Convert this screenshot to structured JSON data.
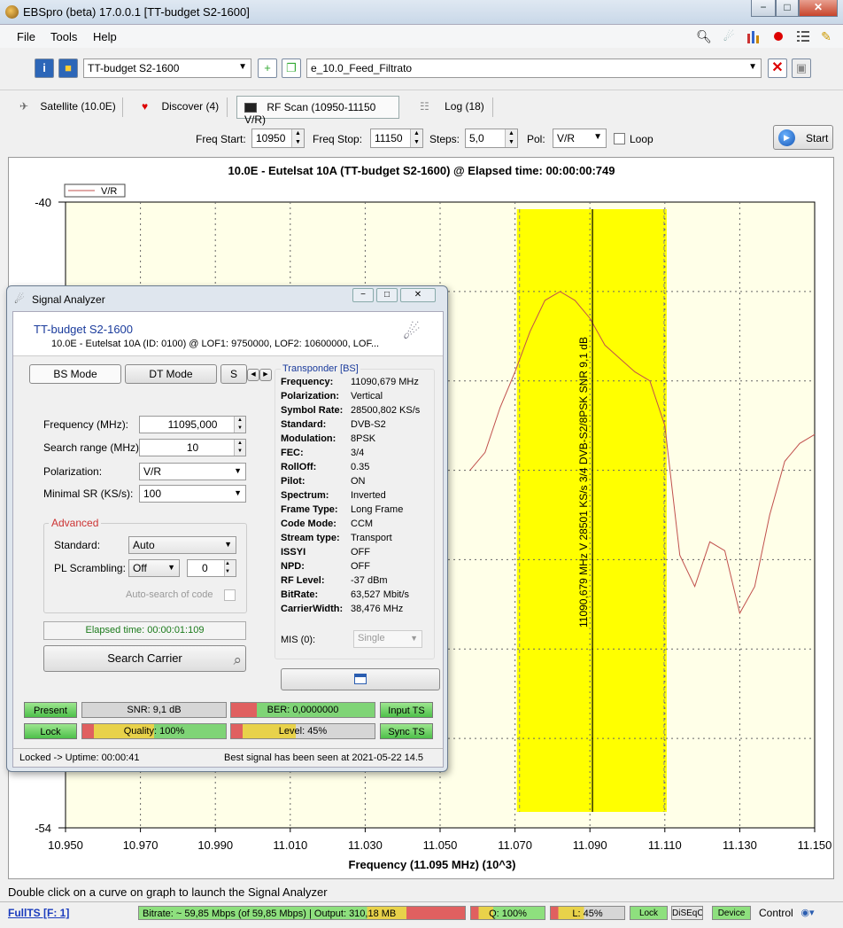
{
  "window": {
    "title": "EBSpro (beta) 17.0.0.1 [TT-budget S2-1600]",
    "min": "−",
    "max": "□",
    "close": "✕"
  },
  "menu": [
    "File",
    "Tools",
    "Help"
  ],
  "toolbar": {
    "device": "TT-budget S2-1600",
    "feed": "e_10.0_Feed_Filtrato"
  },
  "tabs": [
    {
      "label": "Satellite (10.0E)"
    },
    {
      "label": "Discover (4)"
    },
    {
      "label": "RF Scan (10950-11150 V/R)"
    },
    {
      "label": "Log (18)"
    }
  ],
  "scan": {
    "freq_start_label": "Freq Start:",
    "freq_start": "10950",
    "freq_stop_label": "Freq Stop:",
    "freq_stop": "11150",
    "steps_label": "Steps:",
    "steps": "5,0",
    "pol_label": "Pol:",
    "pol": "V/R",
    "loop_label": "Loop",
    "start_label": "Start"
  },
  "chart_data": {
    "type": "line",
    "title": "10.0E  -  Eutelsat 10A    (TT-budget S2-1600) @ Elapsed time: 00:00:00:749",
    "xlabel": "Frequency (11.095 MHz) (10^3)",
    "ylabel": "",
    "xlim": [
      10.95,
      11.15
    ],
    "ylim": [
      -54,
      -40
    ],
    "x_ticks": [
      "10.950",
      "10.970",
      "10.990",
      "11.010",
      "11.030",
      "11.050",
      "11.070",
      "11.090",
      "11.110",
      "11.130",
      "11.150"
    ],
    "y_ticks": [
      "-40",
      "-54"
    ],
    "grid": true,
    "legend": "top-left",
    "series": [
      {
        "name": "V/R",
        "color": "#c0504d",
        "x": [
          11.058,
          11.062,
          11.066,
          11.07,
          11.074,
          11.078,
          11.082,
          11.086,
          11.09,
          11.094,
          11.098,
          11.102,
          11.106,
          11.11,
          11.114,
          11.118,
          11.122,
          11.126,
          11.13,
          11.134,
          11.138,
          11.142,
          11.146,
          11.15
        ],
        "y": [
          -46.0,
          -45.6,
          -44.6,
          -43.8,
          -42.9,
          -42.2,
          -42.0,
          -42.2,
          -42.6,
          -43.2,
          -43.5,
          -43.8,
          -44.0,
          -45.0,
          -47.9,
          -48.6,
          -47.6,
          -47.8,
          -49.2,
          -48.6,
          -47.0,
          -45.8,
          -45.4,
          -45.2
        ]
      }
    ],
    "highlight": {
      "x_start": 11.0705,
      "x_end": 11.1105,
      "color": "#ffff00"
    },
    "marker": {
      "x": 11.090679,
      "label": "11090,679 MHz V 28501 KS/s 3/4 DVB-S2/8PSK SNR 9,1 dB"
    }
  },
  "analyzer": {
    "title": "Signal Analyzer",
    "device": "TT-budget S2-1600",
    "info": "10.0E -  Eutelsat 10A     (ID: 0100) @ LOF1: 9750000, LOF2: 10600000, LOF...",
    "modes": [
      "BS Mode",
      "DT Mode",
      "S"
    ],
    "frequency_label": "Frequency (MHz):",
    "frequency": "11095,000",
    "search_range_label": "Search range (MHz):",
    "search_range": "10",
    "polarization_label": "Polarization:",
    "polarization": "V/R",
    "min_sr_label": "Minimal SR (KS/s):",
    "min_sr": "100",
    "advanced_label": "Advanced",
    "standard_label": "Standard:",
    "standard": "Auto",
    "pl_label": "PL Scrambling:",
    "pl": "Off",
    "pl_value": "0",
    "autosearch_label": "Auto-search of code",
    "elapsed": "Elapsed time: 00:00:01:109",
    "search_btn": "Search Carrier",
    "transponder_label": "Transponder [BS]",
    "transponder": [
      {
        "k": "Frequency:",
        "v": "11090,679 MHz"
      },
      {
        "k": "Polarization:",
        "v": "Vertical"
      },
      {
        "k": "Symbol Rate:",
        "v": "28500,802 KS/s"
      },
      {
        "k": "Standard:",
        "v": "DVB-S2"
      },
      {
        "k": "Modulation:",
        "v": "8PSK"
      },
      {
        "k": "FEC:",
        "v": "3/4"
      },
      {
        "k": "RollOff:",
        "v": "0.35"
      },
      {
        "k": "Pilot:",
        "v": "ON"
      },
      {
        "k": "Spectrum:",
        "v": "Inverted"
      },
      {
        "k": "Frame Type:",
        "v": "Long Frame"
      },
      {
        "k": "Code Mode:",
        "v": "CCM"
      },
      {
        "k": "Stream type:",
        "v": "Transport"
      },
      {
        "k": "ISSYI",
        "v": "OFF"
      },
      {
        "k": "NPD:",
        "v": "OFF"
      },
      {
        "k": "RF Level:",
        "v": "-37 dBm"
      },
      {
        "k": "BitRate:",
        "v": "63,527 Mbit/s"
      },
      {
        "k": "CarrierWidth:",
        "v": "38,476 MHz"
      }
    ],
    "mis_label": "MIS (0):",
    "mis": "Single",
    "present": "Present",
    "lock": "Lock",
    "snr": "SNR: 9,1 dB",
    "quality": "Quality: 100%",
    "ber": "BER: 0,0000000",
    "level": "Level: 45%",
    "input_ts": "Input TS",
    "sync_ts": "Sync TS",
    "status_left": "Locked -> Uptime: 00:00:41",
    "status_right": "Best signal has been seen at 2021-05-22 14.5"
  },
  "status": {
    "message": "Double click on a curve on graph to launch the Signal Analyzer",
    "fullts": "FullTS [F: 1]",
    "bitrate": "Bitrate: ~ 59,85 Mbps (of 59,85 Mbps) | Output: 310,18 MB",
    "q": "Q: 100%",
    "l": "L: 45%",
    "lock": "Lock",
    "diseqc": "DiSEqC",
    "device": "Device",
    "control": "Control"
  }
}
